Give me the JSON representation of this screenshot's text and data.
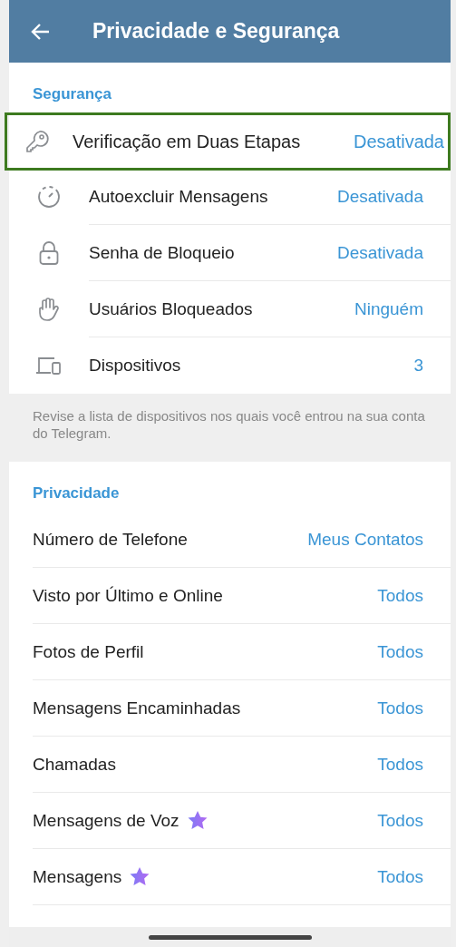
{
  "header": {
    "title": "Privacidade e Segurança"
  },
  "security": {
    "title": "Segurança",
    "items": [
      {
        "kind": "key",
        "label": "Verificação em Duas Etapas",
        "value": "Desativada",
        "highlighted": true
      },
      {
        "kind": "timer",
        "label": "Autoexcluir Mensagens",
        "value": "Desativada",
        "highlighted": false
      },
      {
        "kind": "lock",
        "label": "Senha de Bloqueio",
        "value": "Desativada",
        "highlighted": false
      },
      {
        "kind": "hand",
        "label": "Usuários Bloqueados",
        "value": "Ninguém",
        "highlighted": false
      },
      {
        "kind": "devices",
        "label": "Dispositivos",
        "value": "3",
        "highlighted": false
      }
    ],
    "note": "Revise a lista de dispositivos nos quais você entrou na sua conta do Telegram."
  },
  "privacy": {
    "title": "Privacidade",
    "items": [
      {
        "label": "Número de Telefone",
        "value": "Meus Contatos",
        "premium": false
      },
      {
        "label": "Visto por Último e Online",
        "value": "Todos",
        "premium": false
      },
      {
        "label": "Fotos de Perfil",
        "value": "Todos",
        "premium": false
      },
      {
        "label": "Mensagens Encaminhadas",
        "value": "Todos",
        "premium": false
      },
      {
        "label": "Chamadas",
        "value": "Todos",
        "premium": false
      },
      {
        "label": "Mensagens de Voz",
        "value": "Todos",
        "premium": true
      },
      {
        "label": "Mensagens",
        "value": "Todos",
        "premium": true
      }
    ]
  }
}
